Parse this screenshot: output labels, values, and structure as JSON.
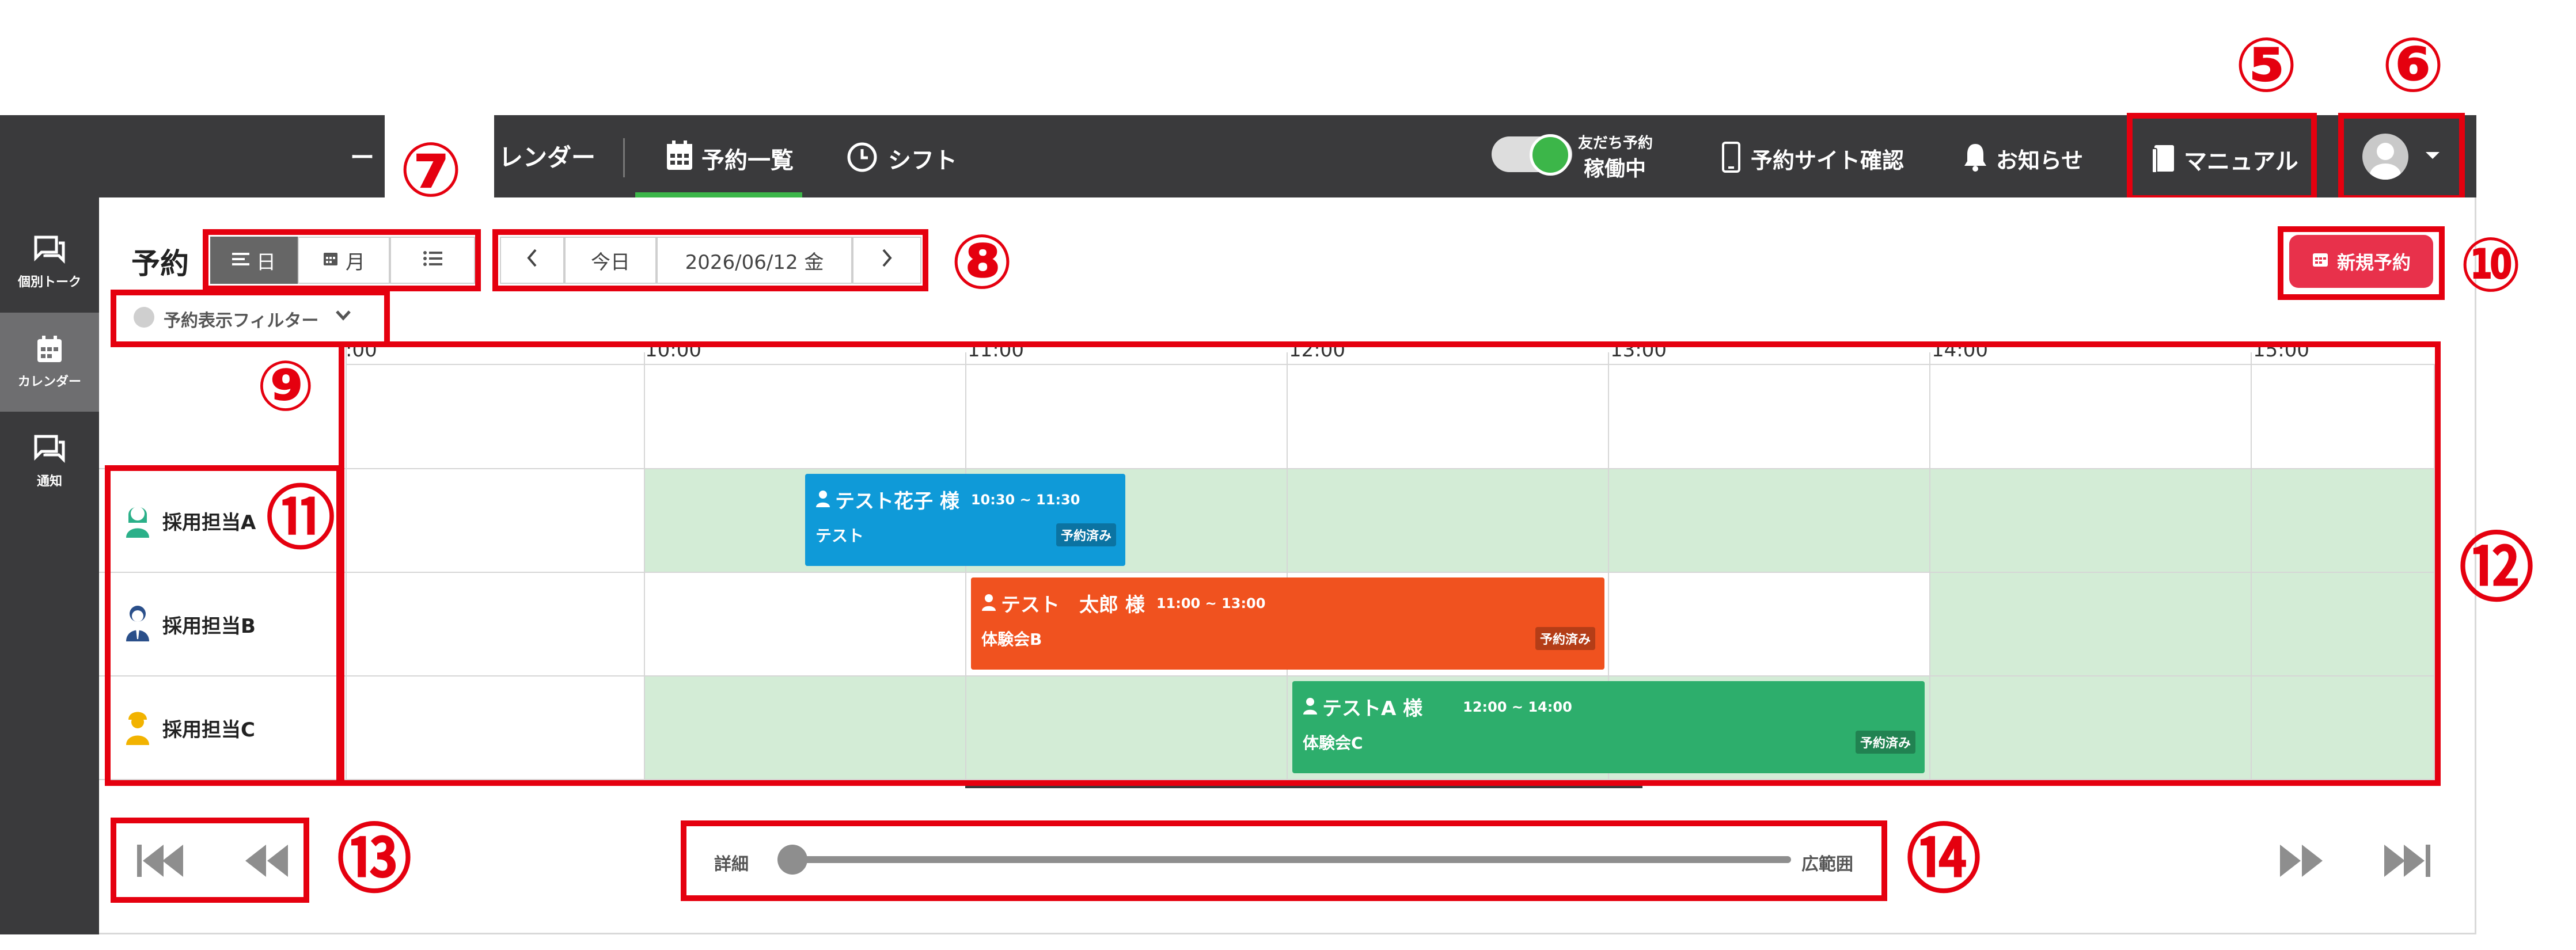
{
  "nav": {
    "partial_left": "ー",
    "active_tab_partial": "レンダー",
    "reservation_list": "予約一覧",
    "shift": "シフト",
    "friend_booking_label": "友だち予約",
    "friend_booking_status": "稼働中",
    "site_check": "予約サイト確認",
    "news": "お知らせ",
    "manual": "マニュアル"
  },
  "sidebar": {
    "items": [
      {
        "label": "個別トーク",
        "icon": "chat-icon"
      },
      {
        "label": "カレンダー",
        "icon": "calendar-icon"
      },
      {
        "label": "通知",
        "icon": "chat-icon"
      }
    ]
  },
  "toolbar": {
    "title": "予約",
    "view_day": "日",
    "view_month": "月",
    "today": "今日",
    "date": "2026/06/12 金",
    "new_booking": "新規予約",
    "filter": "予約表示フィルター"
  },
  "timeline": {
    "hours": [
      ":00",
      "10:00",
      "11:00",
      "12:00",
      "13:00",
      "14:00",
      "15:00"
    ]
  },
  "staff": [
    {
      "name": "採用担当A",
      "color": "#2bb089"
    },
    {
      "name": "採用担当B",
      "color": "#2a4f8a"
    },
    {
      "name": "採用担当C",
      "color": "#f2b300"
    }
  ],
  "bookings": [
    {
      "name": "テスト花子 様",
      "time": "10:30 ~ 11:30",
      "sub": "テスト",
      "badge": "予約済み",
      "color": "#0f9ad8"
    },
    {
      "name": "テスト　太郎 様",
      "time": "11:00 ~ 13:00",
      "sub": "体験会B",
      "badge": "予約済み",
      "color": "#f0521f"
    },
    {
      "name": "テストA 様",
      "time": "12:00 ~ 14:00",
      "sub": "体験会C",
      "badge": "予約済み",
      "color": "#2dae6c"
    }
  ],
  "zoom": {
    "min_label": "詳細",
    "max_label": "広範囲",
    "value": 0
  },
  "annotations": {
    "n5": "⑤",
    "n6": "⑥",
    "n7": "⑦",
    "n8": "⑧",
    "n9": "⑨",
    "n10": "⑩",
    "n11": "⑪",
    "n12": "⑫",
    "n13": "⑬",
    "n14": "⑭"
  },
  "colors": {
    "nav_bg": "#3a3a3c",
    "accent_green": "#3cb649",
    "new_button": "#e8314b",
    "annotation_red": "#e5000f",
    "available_band": "#d3ecd6"
  }
}
